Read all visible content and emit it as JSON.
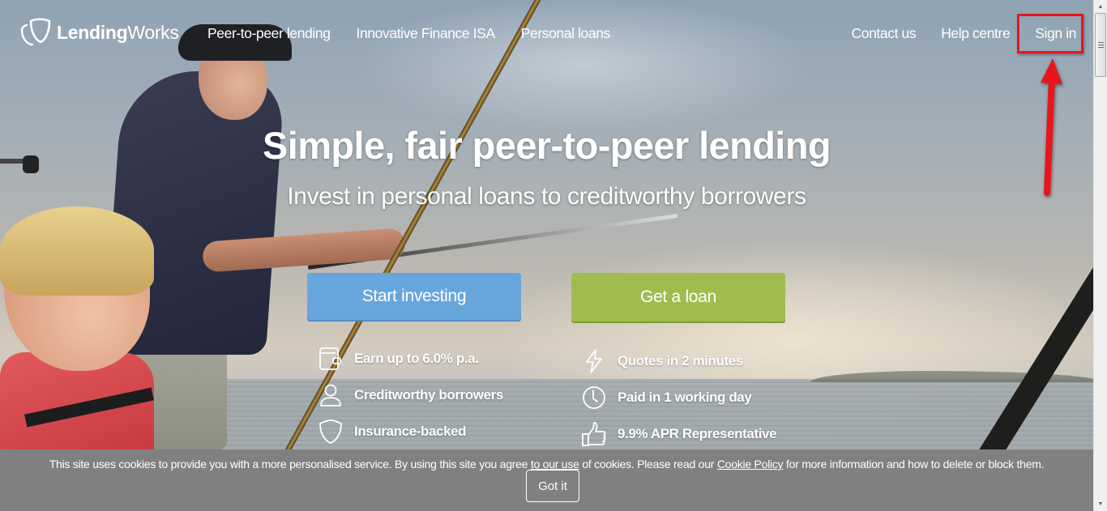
{
  "brand": {
    "name_bold": "Lending",
    "name_light": "Works"
  },
  "nav": {
    "left": [
      {
        "label": "Peer-to-peer lending"
      },
      {
        "label": "Innovative Finance ISA"
      },
      {
        "label": "Personal loans"
      }
    ],
    "right": [
      {
        "label": "Contact us"
      },
      {
        "label": "Help centre"
      },
      {
        "label": "Sign in"
      }
    ]
  },
  "annotation": {
    "target": "Sign in",
    "color": "#e8161a"
  },
  "hero": {
    "title": "Simple, fair peer-to-peer lending",
    "subtitle": "Invest in personal loans to creditworthy borrowers",
    "buttons": {
      "invest": {
        "label": "Start investing",
        "color": "#67a6dc"
      },
      "loan": {
        "label": "Get a loan",
        "color": "#a0bc4f"
      }
    },
    "invest_features": [
      {
        "icon": "wallet-icon",
        "label": "Earn up to 6.0% p.a."
      },
      {
        "icon": "person-icon",
        "label": "Creditworthy borrowers"
      },
      {
        "icon": "shield-icon",
        "label": "Insurance-backed"
      }
    ],
    "loan_features": [
      {
        "icon": "lightning-icon",
        "label": "Quotes in 2 minutes"
      },
      {
        "icon": "clock-icon",
        "label": "Paid in 1 working day"
      },
      {
        "icon": "thumbs-up-icon",
        "label": "9.9% APR Representative"
      }
    ]
  },
  "cookie": {
    "text_1": "This site uses cookies to provide you with a more personalised service. By using this site you agree to ",
    "link_1": "to our use",
    "text_2": " of cookies. Please read our ",
    "link_2": "Cookie Policy",
    "text_3": " for more information and how to delete or block them.",
    "button": "Got it"
  },
  "scrollbar": {
    "up_glyph": "▲",
    "down_glyph": "▼"
  }
}
